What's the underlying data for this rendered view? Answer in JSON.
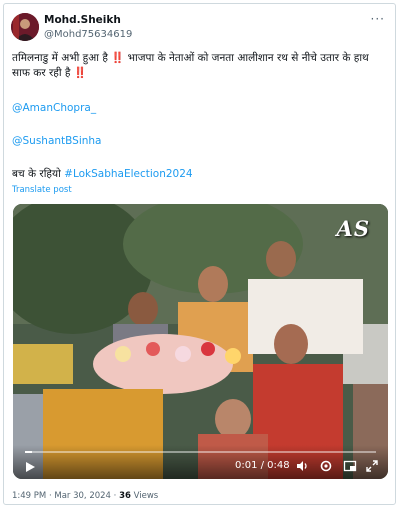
{
  "tweet": {
    "author_name": "Mohd.Sheikh",
    "author_handle": "@Mohd75634619",
    "more_icon": "more-horizontal-icon",
    "text_line1": "तमिलनाडु में अभी हुआ है ‼️ भाजपा के नेताओं को जनता आलीशान रथ से नीचे उतार के हाथ साफ कर रही है ‼️",
    "mention1": "@AmanChopra_",
    "mention2": "@SushantBSinha",
    "text_tail": "बच के रहियो",
    "hashtag": "#LokSabhaElection2024",
    "translate_label": "Translate post"
  },
  "video": {
    "watermark": "AS",
    "time_display": "0:01 / 0:48",
    "progress": 0.02,
    "icons": [
      "play-icon",
      "volume-icon",
      "settings-icon",
      "pip-icon",
      "fullscreen-icon"
    ]
  },
  "footer": {
    "timestamp": "1:49 PM · Mar 30, 2024 · ",
    "views_count": "36",
    "views_label": " Views"
  },
  "colors": {
    "link": "#1d9bf0",
    "text": "#0f1419",
    "muted": "#536471",
    "border": "#cfd9de"
  }
}
